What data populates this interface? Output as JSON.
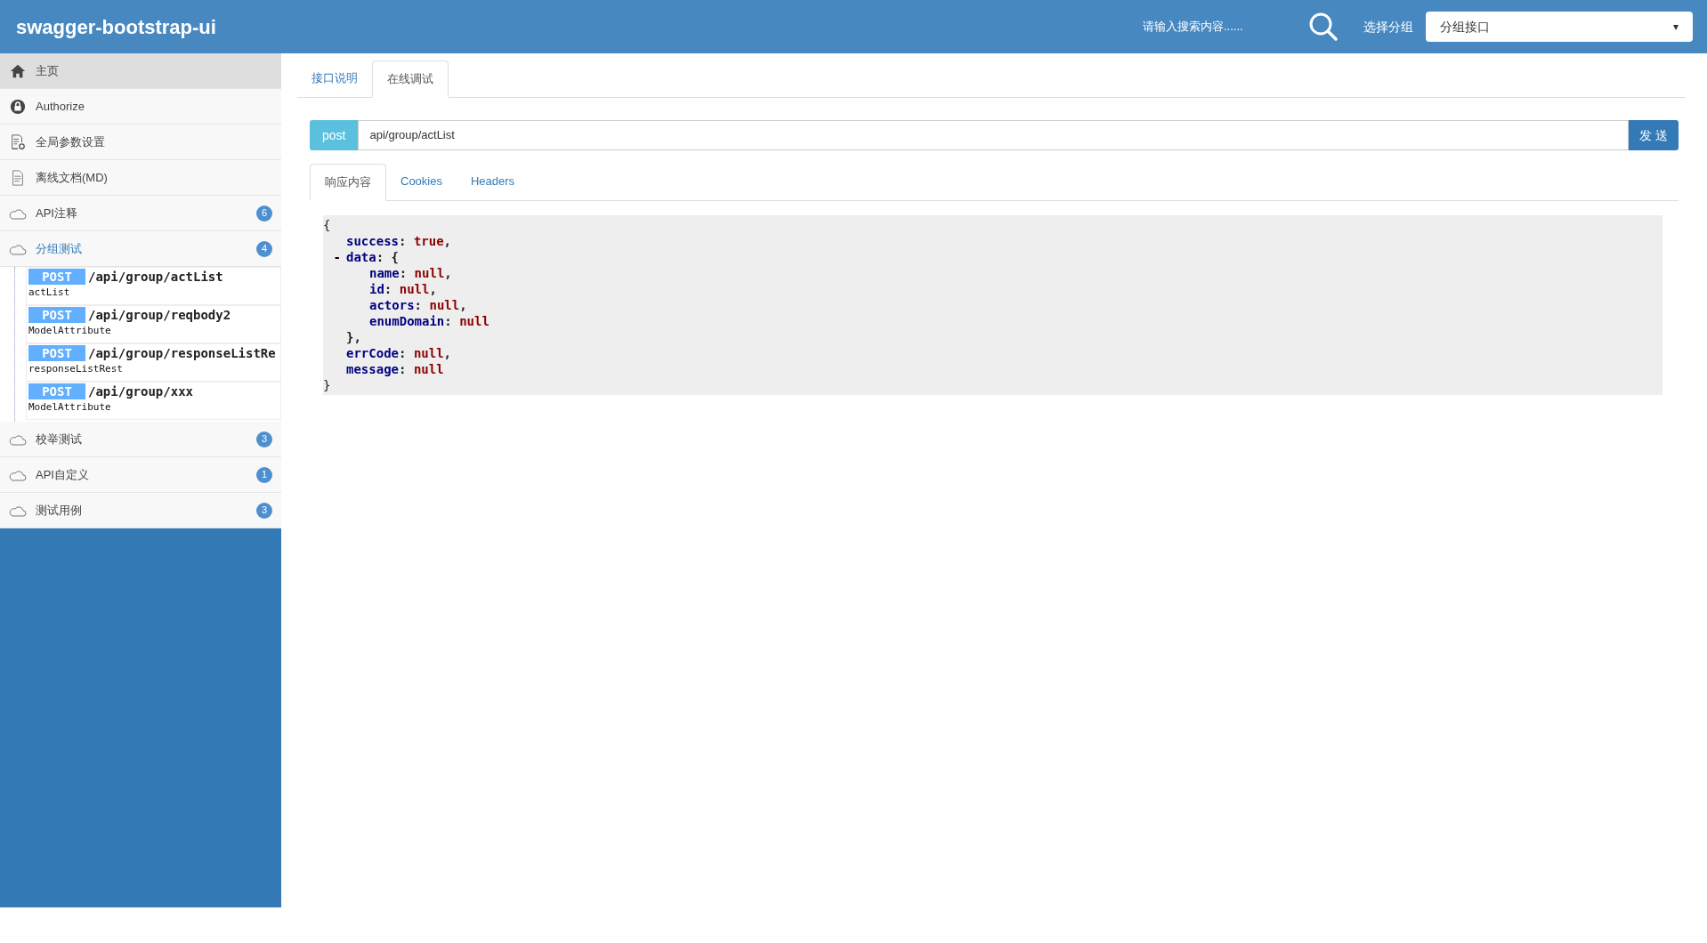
{
  "header": {
    "title": "swagger-bootstrap-ui",
    "search_placeholder": "请输入搜索内容......",
    "group_label": "选择分组",
    "group_value": "分组接口",
    "dropdown_caret": "▾"
  },
  "sidebar": {
    "items": [
      {
        "kind": "home",
        "label": "主页",
        "selected": true
      },
      {
        "kind": "lock",
        "label": "Authorize",
        "selected": false
      },
      {
        "kind": "settings",
        "label": "全局参数设置",
        "selected": false
      },
      {
        "kind": "doc",
        "label": "离线文档(MD)",
        "selected": false
      },
      {
        "kind": "api",
        "label": "API注释",
        "badge": "6",
        "selected": false,
        "expanded": false
      },
      {
        "kind": "api",
        "label": "分组测试",
        "badge": "4",
        "selected": false,
        "expanded": true,
        "children": [
          {
            "method": "POST",
            "path": "/api/group/actList",
            "summary": "actList"
          },
          {
            "method": "POST",
            "path": "/api/group/reqbody2",
            "summary": "ModelAttribute"
          },
          {
            "method": "POST",
            "path": "/api/group/responseListRe",
            "summary": "responseListRest"
          },
          {
            "method": "POST",
            "path": "/api/group/xxx",
            "summary": "ModelAttribute"
          }
        ]
      },
      {
        "kind": "api",
        "label": "校举测试",
        "badge": "3",
        "selected": false,
        "expanded": false
      },
      {
        "kind": "api",
        "label": "API自定义",
        "badge": "1",
        "selected": false,
        "expanded": false
      },
      {
        "kind": "api",
        "label": "测试用例",
        "badge": "3",
        "selected": false,
        "expanded": false
      }
    ]
  },
  "tabs": [
    {
      "label": "接口说明",
      "selected": false
    },
    {
      "label": "在线调试",
      "selected": true
    }
  ],
  "request": {
    "method": "post",
    "url": "api/group/actList",
    "send": "发 送"
  },
  "response_tabs": [
    {
      "label": "响应内容",
      "selected": true
    },
    {
      "label": "Cookies",
      "selected": false
    },
    {
      "label": "Headers",
      "selected": false
    }
  ],
  "body": {
    "open": "{",
    "close": "}",
    "fields": [
      {
        "key": "success",
        "colon": ":",
        "value": "true",
        "comma": ","
      },
      {
        "key": "data",
        "colon": ":",
        "toggle": "-",
        "open": "{",
        "close": "}",
        "comma": ",",
        "children": [
          {
            "key": "name",
            "colon": ":",
            "value": "null",
            "comma": ","
          },
          {
            "key": "id",
            "colon": ":",
            "value": "null",
            "comma": ","
          },
          {
            "key": "actors",
            "colon": ":",
            "value": "null",
            "comma": ","
          },
          {
            "key": "enumDomain",
            "colon": ":",
            "value": "null"
          }
        ]
      },
      {
        "key": "errCode",
        "colon": ":",
        "value": "null",
        "comma": ","
      },
      {
        "key": "message",
        "colon": ":",
        "value": "null"
      }
    ]
  }
}
